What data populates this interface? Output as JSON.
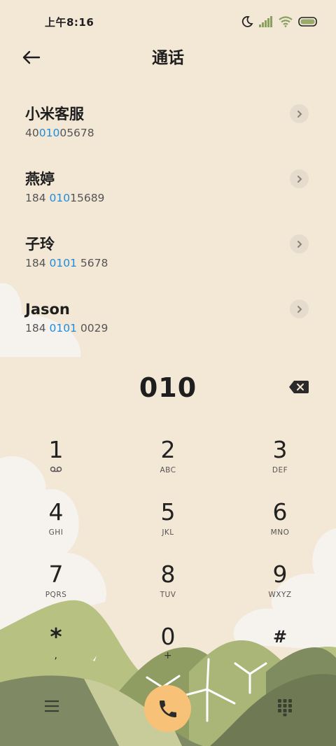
{
  "status_bar": {
    "time": "上午8:16"
  },
  "header": {
    "title": "通话"
  },
  "contacts": [
    {
      "name": "小米客服",
      "num_pre": "40",
      "num_hl": "010",
      "num_post": "05678"
    },
    {
      "name": "燕婷",
      "num_pre": "184 ",
      "num_hl": "010",
      "num_post": "15689"
    },
    {
      "name": "子玲",
      "num_pre": "184 ",
      "num_hl": "0101",
      "num_post": " 5678"
    },
    {
      "name": "Jason",
      "num_pre": "184 ",
      "num_hl": "0101",
      "num_post": " 0029"
    }
  ],
  "input": {
    "digits": "010"
  },
  "keypad": [
    {
      "digit": "1",
      "letters": ""
    },
    {
      "digit": "2",
      "letters": "ABC"
    },
    {
      "digit": "3",
      "letters": "DEF"
    },
    {
      "digit": "4",
      "letters": "GHI"
    },
    {
      "digit": "5",
      "letters": "JKL"
    },
    {
      "digit": "6",
      "letters": "MNO"
    },
    {
      "digit": "7",
      "letters": "PQRS"
    },
    {
      "digit": "8",
      "letters": "TUV"
    },
    {
      "digit": "9",
      "letters": "WXYZ"
    },
    {
      "digit": "*",
      "letters": ","
    },
    {
      "digit": "0",
      "letters": "+"
    },
    {
      "digit": "#",
      "letters": ""
    }
  ],
  "colors": {
    "background": "#f3e7d6",
    "highlight": "#1c8de0",
    "call_button": "#f7c178"
  },
  "icons": [
    "moon-icon",
    "signal-icon",
    "wifi-icon",
    "battery-icon",
    "back-arrow-icon",
    "chevron-right-icon",
    "backspace-icon",
    "voicemail-icon",
    "menu-icon",
    "phone-icon",
    "dialpad-icon"
  ]
}
